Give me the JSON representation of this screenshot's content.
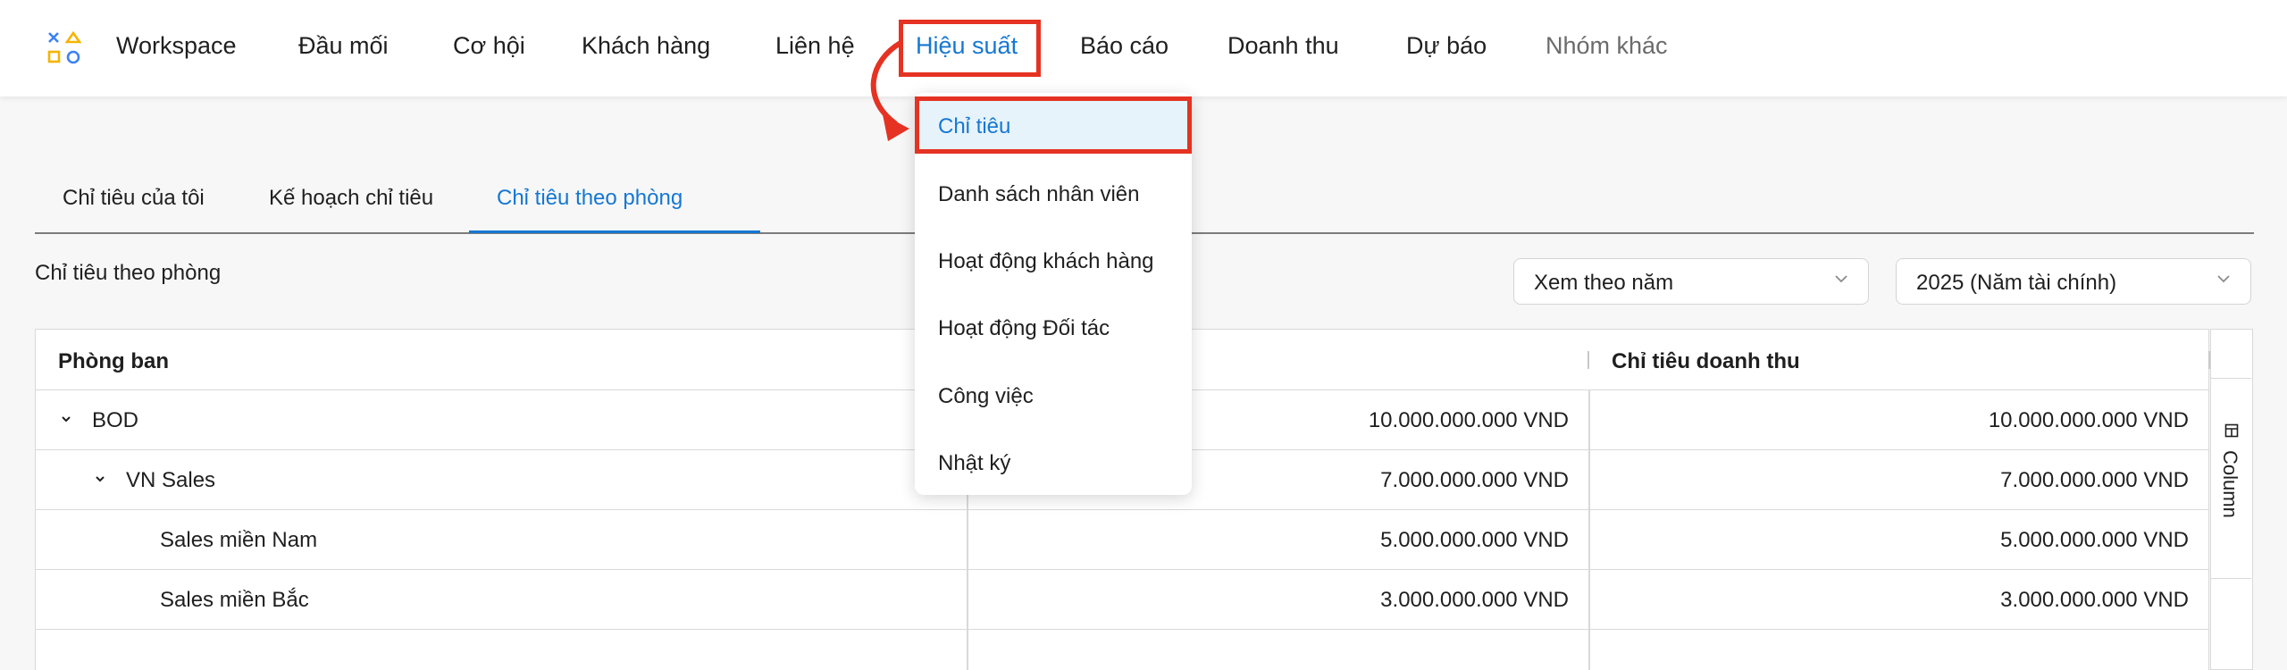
{
  "nav": {
    "items": [
      "Workspace",
      "Đầu mối",
      "Cơ hội",
      "Khách hàng",
      "Liên hệ",
      "Hiệu suất",
      "Báo cáo",
      "Doanh thu",
      "Dự báo",
      "Nhóm khác"
    ],
    "active_index": 5
  },
  "dropdown": {
    "items": [
      "Chỉ tiêu",
      "Danh sách nhân viên",
      "Hoạt động khách hàng",
      "Hoạt động Đối tác",
      "Công việc",
      "Nhật ký"
    ],
    "selected_index": 0
  },
  "tabs": [
    "Chỉ tiêu của tôi",
    "Kế hoạch chỉ tiêu",
    "Chỉ tiêu theo phòng"
  ],
  "active_tab_index": 2,
  "section_title": "Chỉ tiêu theo phòng",
  "filters": {
    "view_mode": "Xem theo năm",
    "year": "2025 (Năm tài chính)"
  },
  "table": {
    "headers": [
      "Phòng ban",
      "",
      "Chỉ tiêu doanh thu"
    ],
    "rows": [
      {
        "name": "BOD",
        "col2": "10.000.000.000 VND",
        "revenue": "10.000.000.000 VND"
      },
      {
        "name": "VN Sales",
        "col2": "7.000.000.000 VND",
        "revenue": "7.000.000.000 VND"
      },
      {
        "name": "Sales miền Nam",
        "col2": "5.000.000.000 VND",
        "revenue": "5.000.000.000 VND"
      },
      {
        "name": "Sales miền Bắc",
        "col2": "3.000.000.000 VND",
        "revenue": "3.000.000.000 VND"
      }
    ]
  },
  "column_panel_label": "Column",
  "colors": {
    "accent": "#1677d2",
    "highlight": "#e53222",
    "selected_bg": "#e6f3fb"
  }
}
